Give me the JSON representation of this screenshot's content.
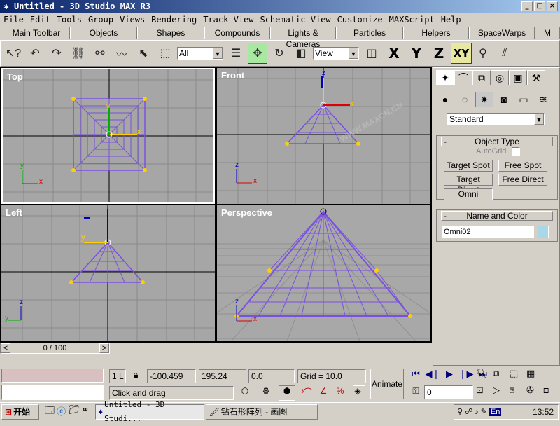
{
  "window": {
    "title": "Untitled - 3D Studio MAX R3",
    "controls": [
      "_",
      "□",
      "×"
    ]
  },
  "menu": [
    "File",
    "Edit",
    "Tools",
    "Group",
    "Views",
    "Rendering",
    "Track View",
    "Schematic View",
    "Customize",
    "MAXScript",
    "Help"
  ],
  "tabs": [
    "Main Toolbar",
    "Objects",
    "Shapes",
    "Compounds",
    "Lights & Cameras",
    "Particles",
    "Helpers",
    "SpaceWarps",
    "M"
  ],
  "toolbar": {
    "selection_filter": "All",
    "reference_coord": "View",
    "axes": [
      "X",
      "Y",
      "Z",
      "XY"
    ]
  },
  "viewports": {
    "top": "Top",
    "front": "Front",
    "left": "Left",
    "perspective": "Perspective"
  },
  "axis_letters": {
    "x": "x",
    "y": "y",
    "z": "z"
  },
  "watermark": "WWW.MAXCN.CN",
  "command_panel": {
    "category": "Standard",
    "object_type": {
      "title": "Object Type",
      "autogrid_label": "AutoGrid",
      "buttons": [
        "Target Spot",
        "Free Spot",
        "Target Direct",
        "Free Direct",
        "Omni"
      ]
    },
    "name_color": {
      "title": "Name and Color",
      "name": "Omni02",
      "color": "#a8d8e8"
    }
  },
  "timeline": {
    "frame": "0 / 100",
    "prev": "<",
    "next": ">"
  },
  "status": {
    "selection_count": "1 L",
    "x": "-100.459",
    "y": "195.24",
    "z": "0.0",
    "grid": "Grid = 10.0",
    "prompt": "Click and drag",
    "animate": "Animate",
    "current_frame": "0",
    "minus_button": "-"
  },
  "taskbar": {
    "start": "开始",
    "tasks": [
      "Untitled - 3D Studi...",
      "钻石形阵列 - 画图"
    ],
    "clock": "13:52",
    "lang": "En"
  }
}
